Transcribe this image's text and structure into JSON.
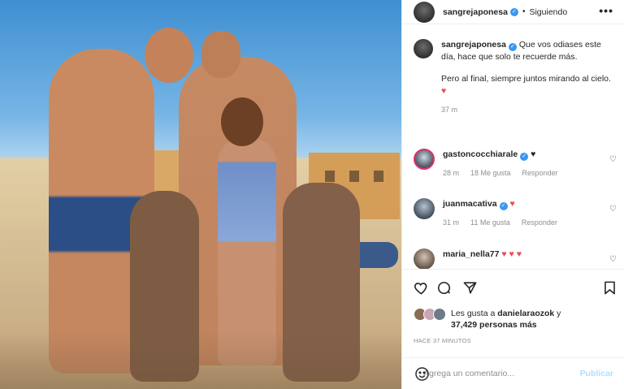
{
  "header": {
    "username": "sangrejaponesa",
    "verified_mark": "✓",
    "separator": "•",
    "follow_label": "Siguiendo",
    "more_label": "•••"
  },
  "caption": {
    "username": "sangrejaponesa",
    "verified_mark": "✓",
    "line1": "Que vos odiases este día, hace que solo te recuerde más.",
    "line2": "Pero al final, siempre juntos mirando al cielo.",
    "heart": "♥",
    "time": "37 m"
  },
  "comments": [
    {
      "username": "gastoncocchiarale",
      "verified_mark": "✓",
      "text": "♥",
      "time": "28 m",
      "likes": "18 Me gusta",
      "reply": "Responder",
      "like_icon": "♡"
    },
    {
      "username": "juanmacativa",
      "verified_mark": "✓",
      "text": "♥",
      "time": "31 m",
      "likes": "11 Me gusta",
      "reply": "Responder",
      "like_icon": "♡"
    },
    {
      "username": "maria_nella77",
      "text": "♥ ♥ ♥",
      "like_icon": "♡"
    }
  ],
  "likes": {
    "prefix": "Les gusta a ",
    "first_user": "danielaraozok",
    "suffix": " y",
    "count": "37,429 personas más"
  },
  "time_ago": "HACE 37 MINUTOS",
  "add_comment": {
    "placeholder": "Agrega un comentario...",
    "publish_label": "Publicar"
  },
  "icons": {
    "like": "heart-outline-icon",
    "comment": "comment-bubble-icon",
    "share": "paper-plane-icon",
    "save": "bookmark-icon",
    "emoji": "emoji-icon"
  },
  "colors": {
    "verified": "#3897f0",
    "heart": "#ed4956",
    "publish_disabled": "#b2dffc",
    "muted": "#8e8e8e"
  }
}
